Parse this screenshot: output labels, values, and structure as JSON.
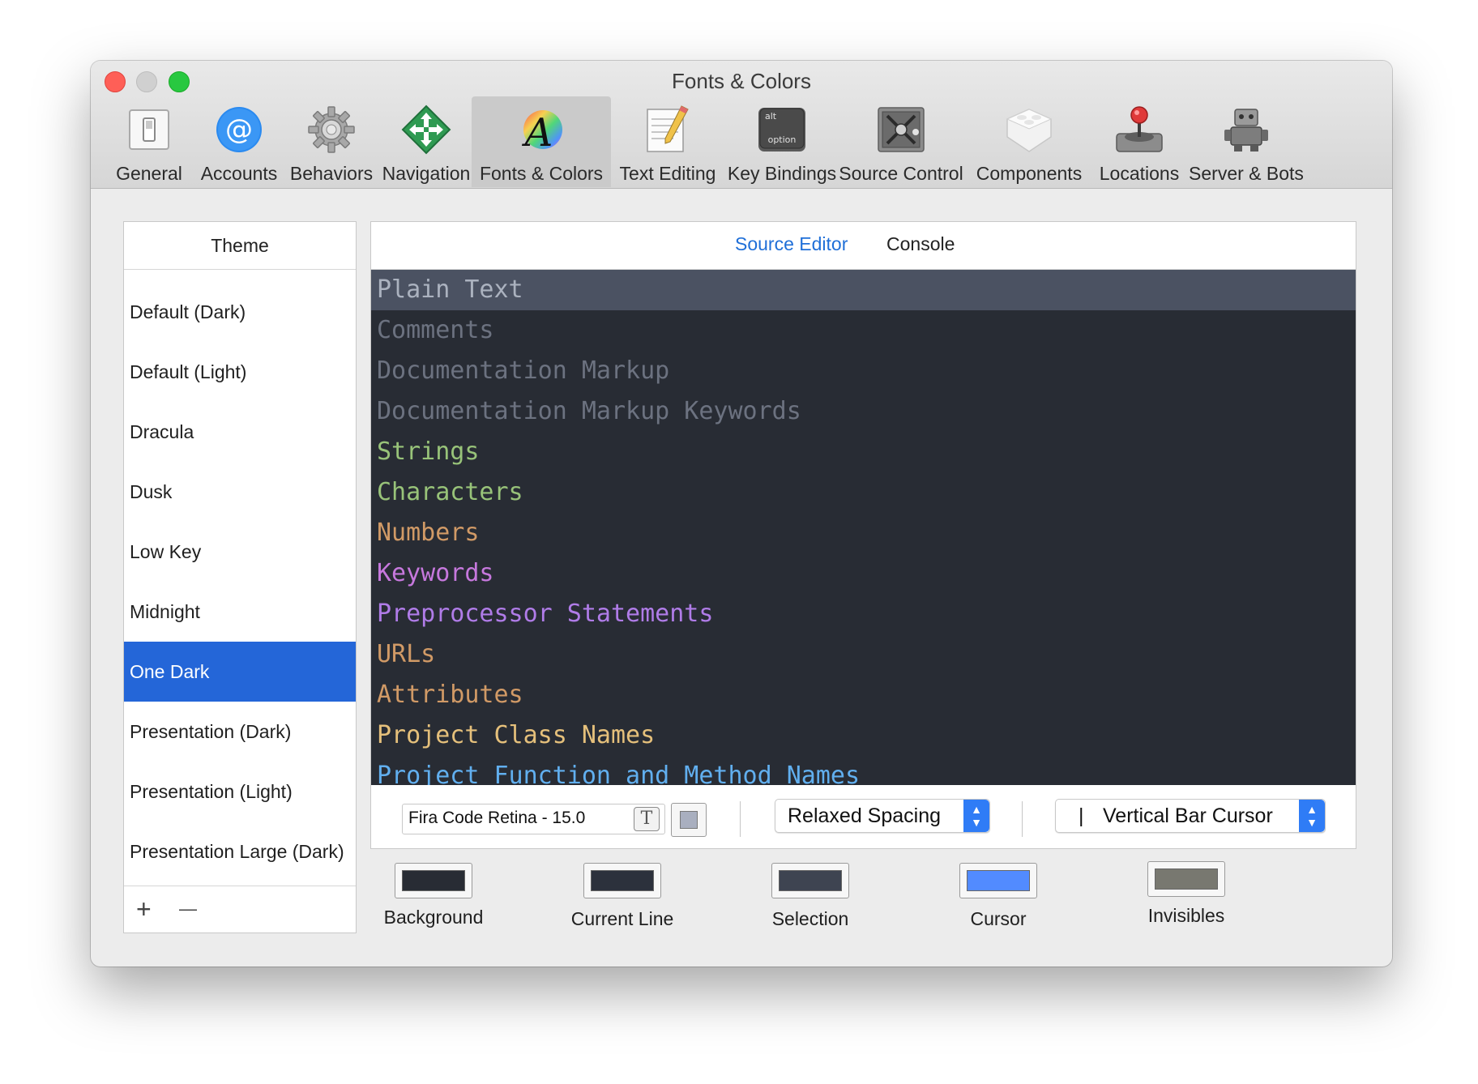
{
  "window": {
    "title": "Fonts & Colors"
  },
  "toolbar": {
    "items": [
      {
        "label": "General",
        "icon": "general-switch-icon"
      },
      {
        "label": "Accounts",
        "icon": "at-sign-icon"
      },
      {
        "label": "Behaviors",
        "icon": "gear-icon"
      },
      {
        "label": "Navigation",
        "icon": "navigation-arrows-icon"
      },
      {
        "label": "Fonts & Colors",
        "icon": "font-color-a-icon",
        "active": true
      },
      {
        "label": "Text Editing",
        "icon": "notepad-pencil-icon"
      },
      {
        "label": "Key Bindings",
        "icon": "option-key-icon",
        "key_top": "alt",
        "key_bottom": "option"
      },
      {
        "label": "Source Control",
        "icon": "safe-icon"
      },
      {
        "label": "Components",
        "icon": "lego-brick-icon"
      },
      {
        "label": "Locations",
        "icon": "joystick-drive-icon"
      },
      {
        "label": "Server & Bots",
        "icon": "robot-icon"
      }
    ]
  },
  "theme_panel": {
    "header": "Theme",
    "themes": [
      "Default (Dark)",
      "Default (Light)",
      "Dracula",
      "Dusk",
      "Low Key",
      "Midnight",
      "One Dark",
      "Presentation (Dark)",
      "Presentation (Light)",
      "Presentation Large (Dark)"
    ],
    "selected": "One Dark",
    "add_label": "+",
    "remove_label": "—"
  },
  "editor": {
    "tabs": {
      "source_editor": "Source Editor",
      "console": "Console",
      "active": "Source Editor"
    },
    "syntax_items": [
      {
        "label": "Plain Text",
        "color": "#abb2bf",
        "current": true
      },
      {
        "label": "Comments",
        "color": "#6c7280"
      },
      {
        "label": "Documentation Markup",
        "color": "#6c7280"
      },
      {
        "label": "Documentation Markup Keywords",
        "color": "#6c7280"
      },
      {
        "label": "Strings",
        "color": "#98c379"
      },
      {
        "label": "Characters",
        "color": "#98c379"
      },
      {
        "label": "Numbers",
        "color": "#d19a66"
      },
      {
        "label": "Keywords",
        "color": "#c678dd"
      },
      {
        "label": "Preprocessor Statements",
        "color": "#b07ce8"
      },
      {
        "label": "URLs",
        "color": "#d19a66"
      },
      {
        "label": "Attributes",
        "color": "#d19a66"
      },
      {
        "label": "Project Class Names",
        "color": "#e5c07b"
      },
      {
        "label": "Project Function and Method Names",
        "color": "#61afef"
      }
    ],
    "background_color": "#282c34",
    "current_line_color": "#4b5262",
    "font": {
      "value": "Fira Code Retina - 15.0",
      "picker_glyph": "T"
    },
    "spacing": {
      "value": "Relaxed Spacing"
    },
    "cursor": {
      "glyph": "|",
      "value": "Vertical Bar Cursor"
    }
  },
  "swatches": [
    {
      "label": "Background",
      "color": "#282c34"
    },
    {
      "label": "Current Line",
      "color": "#2c313c"
    },
    {
      "label": "Selection",
      "color": "#3e4451"
    },
    {
      "label": "Cursor",
      "color": "#528bff"
    },
    {
      "label": "Invisibles",
      "color": "#787870"
    }
  ]
}
